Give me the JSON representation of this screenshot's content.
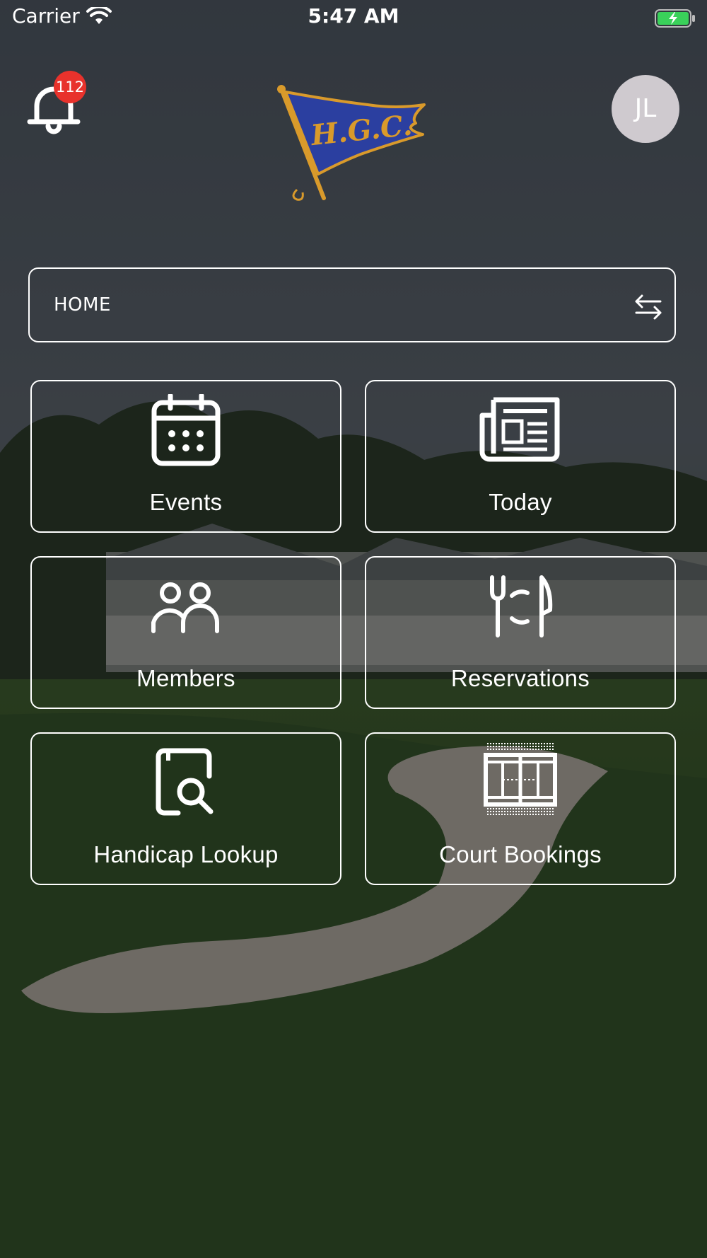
{
  "status_bar": {
    "carrier": "Carrier",
    "time": "5:47 AM"
  },
  "header": {
    "notification_count": "112",
    "logo_text": "H.G.C.",
    "avatar_initials": "JL"
  },
  "home_selector": {
    "label": "HOME"
  },
  "tiles": [
    {
      "label": "Events",
      "icon": "calendar-icon"
    },
    {
      "label": "Today",
      "icon": "newspaper-icon"
    },
    {
      "label": "Members",
      "icon": "members-icon"
    },
    {
      "label": "Reservations",
      "icon": "dining-icon"
    },
    {
      "label": "Handicap Lookup",
      "icon": "handicap-search-icon"
    },
    {
      "label": "Court Bookings",
      "icon": "tennis-court-icon"
    }
  ],
  "colors": {
    "badge": "#e8322c",
    "avatar": "#cfcacf",
    "logo_flag": "#2b3fa0",
    "logo_gold": "#d99a2b",
    "battery_fill": "#3ad15a"
  }
}
